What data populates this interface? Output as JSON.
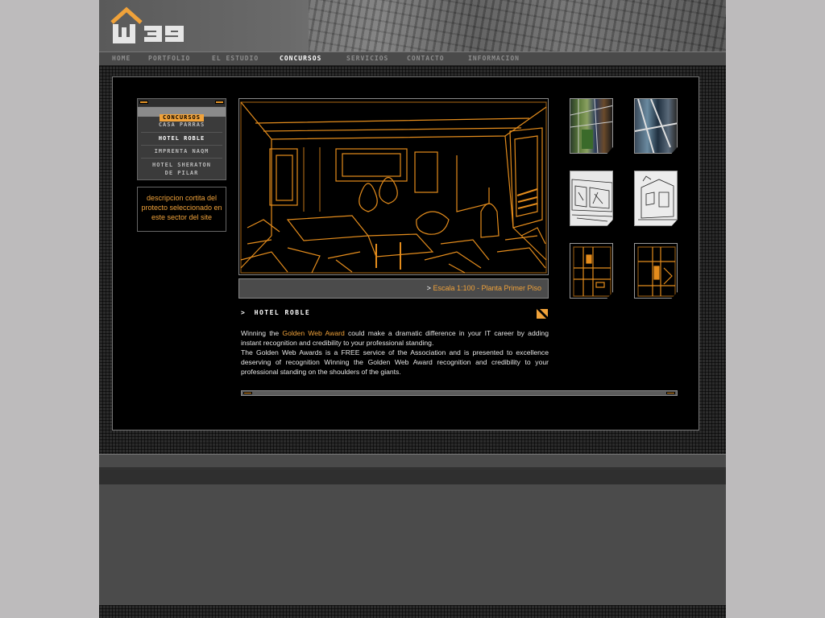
{
  "brand": {
    "logo_text": "w39",
    "accent": "#f0a23a"
  },
  "nav": {
    "items": [
      {
        "label": "HOME",
        "active": false
      },
      {
        "label": "PORTFOLIO",
        "active": false
      },
      {
        "label": "EL ESTUDIO",
        "active": false
      },
      {
        "label": "CONCURSOS",
        "active": true
      },
      {
        "label": "SERVICIOS",
        "active": false
      },
      {
        "label": "CONTACTO",
        "active": false
      },
      {
        "label": "INFORMACION",
        "active": false
      }
    ]
  },
  "submenu": {
    "header": "CONCURSOS",
    "items": [
      {
        "label": "CASA PARRAS",
        "active": false
      },
      {
        "label": "HOTEL ROBLE",
        "active": true
      },
      {
        "label": "IMPRENTA NAQM",
        "active": false
      },
      {
        "label": "HOTEL SHERATON",
        "label2": "DE PILAR",
        "active": false
      }
    ]
  },
  "description_box": "descripcion cortita del protecto seleccionado en este sector del site",
  "main_image": {
    "caption_arrow": ">",
    "caption": "Escala 1:100 - Planta Primer Piso"
  },
  "project": {
    "title_prefix": ">",
    "title": "HOTEL ROBLE",
    "text": {
      "p1_before": "Winning the ",
      "p1_link": "Golden Web Award",
      "p1_after": " could make a dramatic difference in your IT career by adding instant recognition and credibility to your professional standing.",
      "p2": "The Golden Web Awards is a FREE service of the Association and is presented to excellence deserving of recognition Winning the Golden Web Award recognition and credibility to your professional standing on the shoulders of the giants."
    }
  },
  "thumbnails": [
    {
      "kind": "photo-color"
    },
    {
      "kind": "photo-color-2"
    },
    {
      "kind": "sketch-bw"
    },
    {
      "kind": "sketch-bw-2"
    },
    {
      "kind": "section-orange"
    },
    {
      "kind": "section-orange-2"
    }
  ]
}
